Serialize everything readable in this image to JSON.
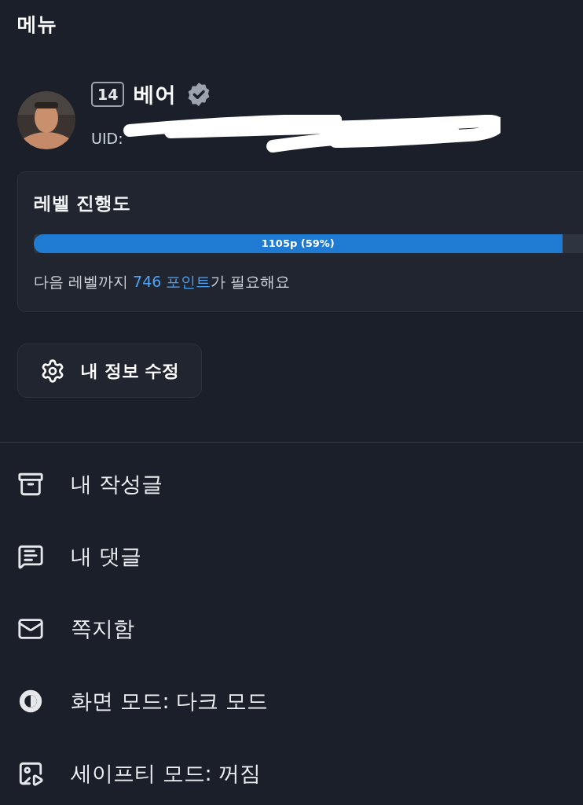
{
  "header": {
    "title": "메뉴"
  },
  "profile": {
    "level_badge": "14",
    "name": "베어",
    "verified": true,
    "uid_label": "UID:"
  },
  "level_card": {
    "title": "레벨 진행도",
    "progress": {
      "level": 0.59,
      "label": "1105p (59%)"
    },
    "note": "다음 레벨까지 **746 포인트**가 필요해요"
  },
  "edit_button": {
    "label": "내 정보 수정"
  },
  "menu": [
    {
      "label": "내 작성글"
    },
    {
      "label": "내 댓글"
    },
    {
      "label": "쪽지함"
    },
    {
      "label": "화면 모드: 다크 모드"
    },
    {
      "label": "세이프티 모드: 꺼짐"
    }
  ]
}
